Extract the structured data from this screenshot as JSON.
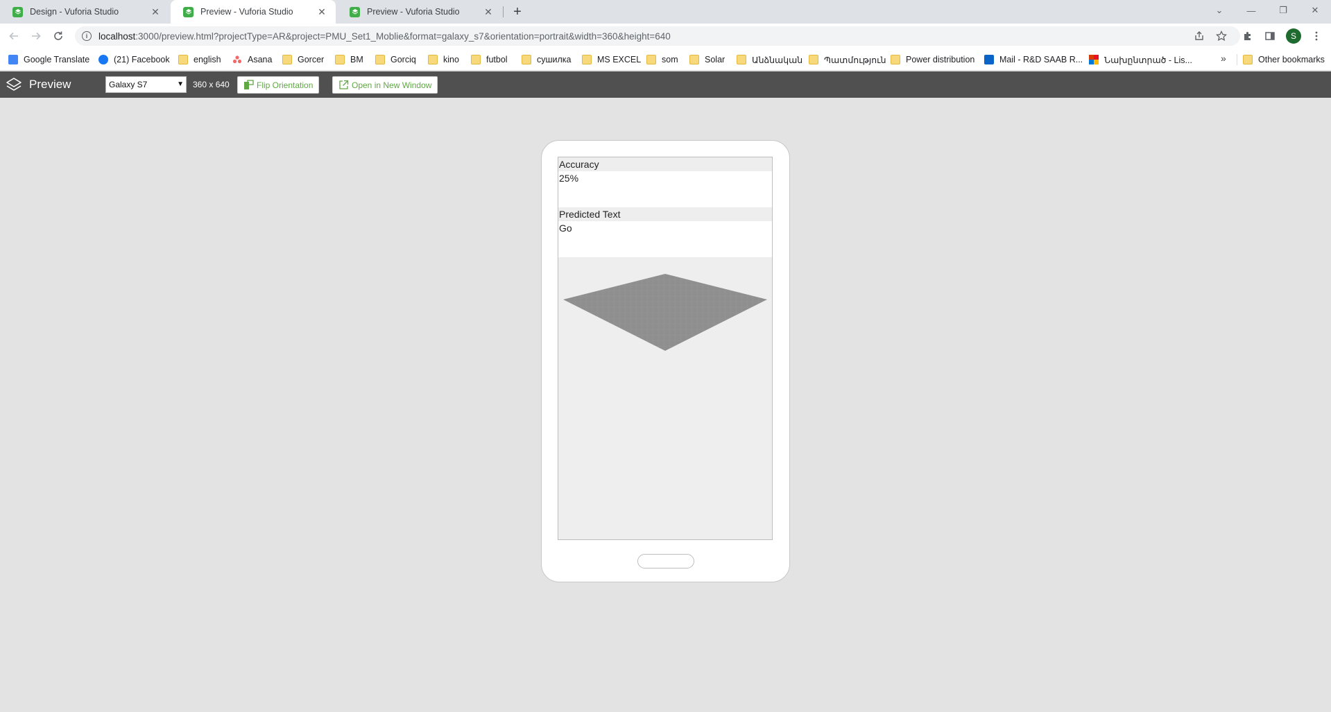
{
  "browser": {
    "tabs": [
      {
        "title": "Design - Vuforia Studio",
        "active": false
      },
      {
        "title": "Preview - Vuforia Studio",
        "active": true
      },
      {
        "title": "Preview - Vuforia Studio",
        "active": false
      }
    ],
    "url": {
      "host": "localhost",
      "path": ":3000/preview.html?projectType=AR&project=PMU_Set1_Moblie&format=galaxy_s7&orientation=portrait&width=360&height=640"
    },
    "avatar_letter": "S",
    "bookmarks": [
      {
        "label": "Google Translate",
        "icon": "google-translate-icon"
      },
      {
        "label": "(21) Facebook",
        "icon": "facebook-icon"
      },
      {
        "label": "english",
        "icon": "folder-icon"
      },
      {
        "label": "Asana",
        "icon": "asana-icon"
      },
      {
        "label": "Gorcer",
        "icon": "folder-icon"
      },
      {
        "label": "BM",
        "icon": "folder-icon"
      },
      {
        "label": "Gorciq",
        "icon": "folder-icon"
      },
      {
        "label": "kino",
        "icon": "folder-icon"
      },
      {
        "label": "futbol",
        "icon": "folder-icon"
      },
      {
        "label": "сушилка",
        "icon": "folder-icon"
      },
      {
        "label": "MS EXCEL",
        "icon": "folder-icon"
      },
      {
        "label": "som",
        "icon": "folder-icon"
      },
      {
        "label": "Solar",
        "icon": "folder-icon"
      },
      {
        "label": "Անձնական",
        "icon": "folder-icon"
      },
      {
        "label": "Պատմություն",
        "icon": "folder-icon"
      },
      {
        "label": "Power distribution",
        "icon": "folder-icon"
      },
      {
        "label": "Mail - R&D SAAB R...",
        "icon": "outlook-icon"
      },
      {
        "label": "Նախընտրած - Lis...",
        "icon": "office-icon"
      }
    ],
    "more_bookmarks": "»",
    "other_bookmarks": "Other bookmarks"
  },
  "app": {
    "title": "Preview",
    "device_select": "Galaxy S7",
    "resolution": "360 x 640",
    "flip_label": "Flip Orientation",
    "open_label": "Open in New Window",
    "brand_color": "#5fa844"
  },
  "preview": {
    "accuracy_label": "Accuracy",
    "accuracy_value": "25%",
    "predicted_label": "Predicted Text",
    "predicted_value": "Go"
  }
}
